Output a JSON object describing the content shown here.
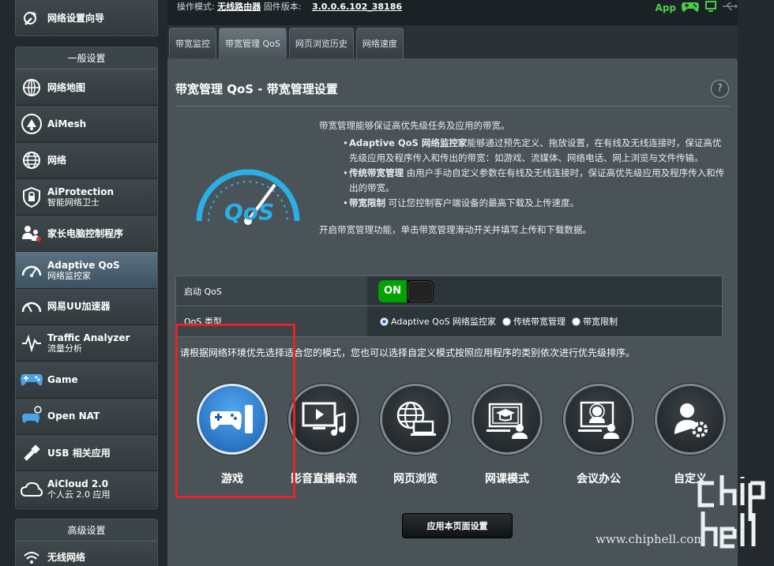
{
  "sidebar": {
    "wizard": {
      "label": "网络设置向导",
      "icon": "wizard-icon"
    },
    "general_title": "一般设置",
    "general_items": [
      {
        "name": "sidebar-item-network-map",
        "icon": "network-map-icon",
        "label": "网络地图",
        "label2": ""
      },
      {
        "name": "sidebar-item-aimesh",
        "icon": "aimesh-icon",
        "label": "AiMesh",
        "label2": ""
      },
      {
        "name": "sidebar-item-network",
        "icon": "globe-icon",
        "label": "网络",
        "label2": ""
      },
      {
        "name": "sidebar-item-aiprotection",
        "icon": "shield-lock-icon",
        "label": "AiProtection",
        "label2": "智能网络卫士"
      },
      {
        "name": "sidebar-item-parental-controls",
        "icon": "parental-icon",
        "label": "家长电脑控制程序",
        "label2": ""
      },
      {
        "name": "sidebar-item-adaptive-qos",
        "icon": "speedometer-icon",
        "label": "Adaptive QoS",
        "label2": "网络监控家",
        "active": true
      },
      {
        "name": "sidebar-item-uu-booster",
        "icon": "gauge-icon",
        "label": "网易UU加速器",
        "label2": ""
      },
      {
        "name": "sidebar-item-traffic-analyzer",
        "icon": "pulse-icon",
        "label": "Traffic Analyzer",
        "label2": "流量分析"
      },
      {
        "name": "sidebar-item-game",
        "icon": "gamepad-icon",
        "label": "Game",
        "label2": ""
      },
      {
        "name": "sidebar-item-open-nat",
        "icon": "open-nat-icon",
        "label": "Open NAT",
        "label2": ""
      },
      {
        "name": "sidebar-item-usb",
        "icon": "usb-icon",
        "label": "USB 相关应用",
        "label2": ""
      },
      {
        "name": "sidebar-item-aicloud",
        "icon": "cloud-icon",
        "label": "AiCloud 2.0",
        "label2": "个人云 2.0 应用"
      }
    ],
    "advanced_title": "高级设置",
    "advanced_items": [
      {
        "name": "sidebar-item-wireless",
        "icon": "wifi-icon",
        "label": "无线网络"
      }
    ]
  },
  "topbar": {
    "mode_label": "操作模式:",
    "mode_value": "无线路由器",
    "firmware_label": "固件版本:",
    "firmware_value": "3.0.0.6.102_38186",
    "app_label": "App"
  },
  "tabs": [
    {
      "label": "带宽监控",
      "active": false
    },
    {
      "label": "带宽管理 QoS",
      "active": true
    },
    {
      "label": "网页浏览历史",
      "active": false
    },
    {
      "label": "网络速度",
      "active": false
    }
  ],
  "panel": {
    "title": "带宽管理 QoS - 带宽管理设置",
    "help": "?",
    "intro": "带宽管理能够保证高优先级任务及应用的带宽。",
    "bullets": [
      {
        "bold": "Adaptive QoS 网络监控家",
        "text": "能够通过预先定义、拖放设置，在有线及无线连接时，保证高优先级应用及程序传入和传出的带宽：如游戏、流媒体、网络电话、网上浏览与文件传输。"
      },
      {
        "bold": "传统带宽管理",
        "text": " 由用户手动自定义参数在有线及无线连接时，保证高优先级应用及程序传入和传出的带宽。"
      },
      {
        "bold": "带宽限制",
        "text": " 可让您控制客户端设备的最高下载及上传速度。"
      }
    ],
    "enable_note": "开启带宽管理功能，单击带宽管理滑动开关并填写上传和下载数据。",
    "logo_text": "QoS"
  },
  "settings": {
    "enable_label": "启动 QoS",
    "toggle_on": "ON",
    "type_label": "QoS 类型",
    "type_options": [
      "Adaptive QoS 网络监控家",
      "传统带宽管理",
      "带宽限制"
    ],
    "type_selected": 0
  },
  "modes_hint": "请根据网络环境优先选择适合您的模式，您也可以选择自定义模式按照应用程序的类别依次进行优先级排序。",
  "modes": [
    {
      "name": "mode-gaming",
      "icon": "gamepad-icon",
      "label": "游戏",
      "selected": true
    },
    {
      "name": "mode-streaming",
      "icon": "streaming-icon",
      "label": "影音直播串流",
      "selected": false
    },
    {
      "name": "mode-web-browsing",
      "icon": "web-browsing-icon",
      "label": "网页浏览",
      "selected": false
    },
    {
      "name": "mode-online-class",
      "icon": "online-class-icon",
      "label": "网课模式",
      "selected": false
    },
    {
      "name": "mode-meeting",
      "icon": "meeting-icon",
      "label": "会议办公",
      "selected": false
    },
    {
      "name": "mode-custom",
      "icon": "custom-gear-icon",
      "label": "自定义",
      "selected": false
    }
  ],
  "apply_label": "应用本页面设置",
  "watermark": "www.chiphell.com",
  "colors": {
    "accent_blue": "#2a71d0",
    "on_green": "#00a300",
    "highlight_red": "#e0242a"
  }
}
